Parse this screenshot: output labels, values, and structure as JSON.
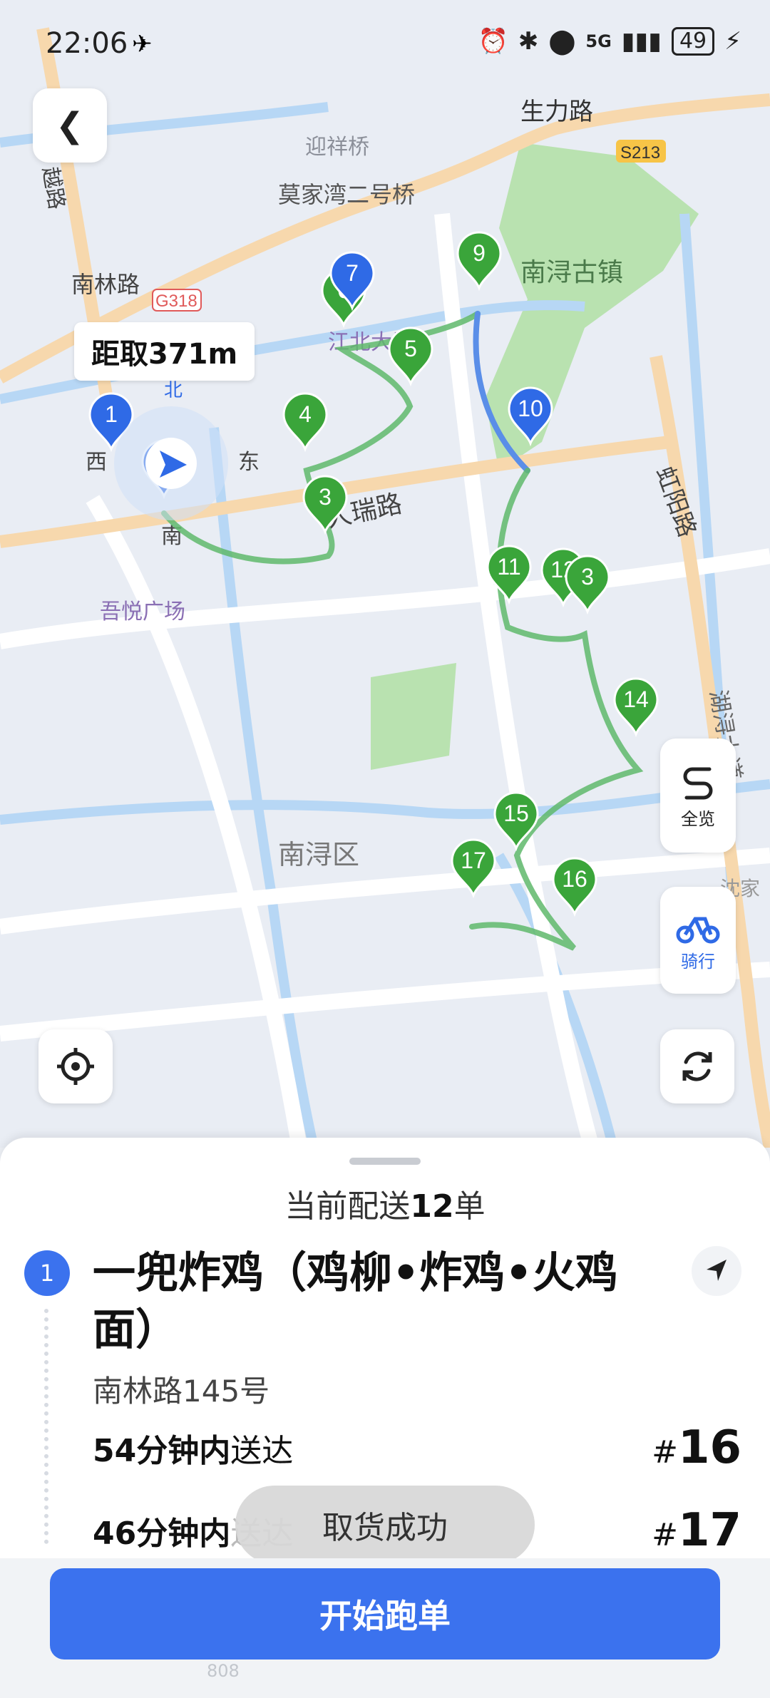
{
  "status_bar": {
    "time": "22:06",
    "network": "5G",
    "battery": "49"
  },
  "map": {
    "labels": {
      "shengli_road": "生力路",
      "s213": "S213",
      "yingxiang_bridge": "迎祥桥",
      "mojiawan_bridge": "莫家湾二号桥",
      "nanxun_town": "南浔古镇",
      "nanlin_road": "南林路",
      "g318": "G318",
      "jiangbei_building": "江北大厦",
      "west": "西",
      "east": "东",
      "north": "北",
      "south": "南",
      "rui_road": "人瑞路",
      "hongyang_road": "虹阳路",
      "wuyue_plaza": "吾悦广场",
      "huxun_avenue": "湖浔大道",
      "nanxun_district": "南浔区",
      "shenjia": "沈家",
      "yue_road": "越路"
    },
    "distance_tag": "距取371m",
    "markers": [
      "1",
      "2",
      "3",
      "4",
      "5",
      "6",
      "7",
      "9",
      "10",
      "11",
      "12",
      "3",
      "14",
      "15",
      "16",
      "17"
    ],
    "buttons": {
      "overview_label": "全览",
      "ride_label": "骑行"
    },
    "colors": {
      "route_green": "#5fb86b",
      "route_blue": "#5a8ee8",
      "marker_green": "#3aa53a",
      "marker_blue": "#2f6ae6"
    }
  },
  "sheet": {
    "current_prefix": "当前配送",
    "current_count": "12",
    "current_suffix": "单",
    "order_index": "1",
    "shop_name": "一兜炸鸡（鸡柳•炸鸡•火鸡面）",
    "address": "南林路145号",
    "rows": [
      {
        "time_bold": "54分钟内",
        "time_rest": "送达",
        "hash": "#",
        "num": "16"
      },
      {
        "time_bold": "46分钟内",
        "time_rest": "送达",
        "hash": "#",
        "num": "17"
      }
    ],
    "toast": "取货成功",
    "cta": "开始跑单",
    "footnote": "808"
  }
}
